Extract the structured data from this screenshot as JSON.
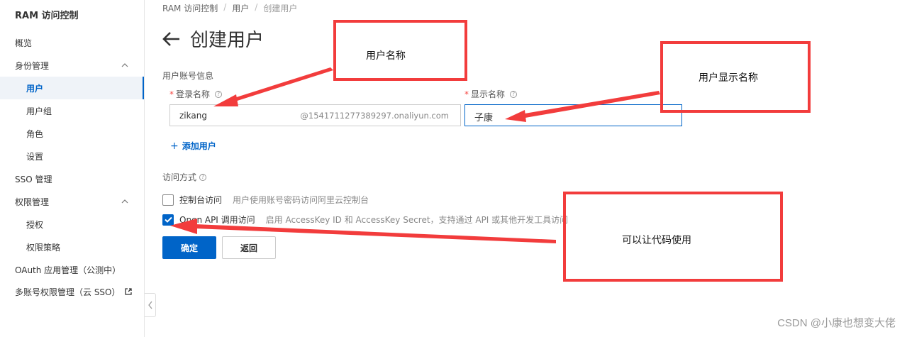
{
  "sidebar": {
    "title": "RAM 访问控制",
    "items": [
      {
        "label": "概览"
      },
      {
        "label": "身份管理"
      },
      {
        "label": "用户"
      },
      {
        "label": "用户组"
      },
      {
        "label": "角色"
      },
      {
        "label": "设置"
      },
      {
        "label": "SSO 管理"
      },
      {
        "label": "权限管理"
      },
      {
        "label": "授权"
      },
      {
        "label": "权限策略"
      },
      {
        "label": "OAuth 应用管理（公测中）"
      },
      {
        "label": "多账号权限管理（云 SSO）"
      }
    ]
  },
  "breadcrumb": [
    "RAM 访问控制",
    "用户",
    "创建用户"
  ],
  "page_title": "创建用户",
  "form": {
    "section_account": "用户账号信息",
    "login_label": "登录名称",
    "login_value": "zikang",
    "login_suffix": "@1541711277389297.onaliyun.com",
    "display_label": "显示名称",
    "display_value": "子康",
    "add_user": "添加用户",
    "section_access": "访问方式",
    "console_label": "控制台访问",
    "console_desc": "用户使用账号密码访问阿里云控制台",
    "console_checked": false,
    "api_label": "Open API 调用访问",
    "api_desc": "启用 AccessKey ID 和 AccessKey Secret，支持通过 API 或其他开发工具访问",
    "api_checked": true,
    "ok_button": "确定",
    "back_button": "返回"
  },
  "annotations": {
    "box1": "用户名称",
    "box2": "用户显示名称",
    "box3": "可以让代码使用",
    "color": "#f23c3c"
  },
  "watermark": "CSDN @小康也想变大佬",
  "colors": {
    "primary": "#0064c8",
    "required": "#f54743"
  }
}
